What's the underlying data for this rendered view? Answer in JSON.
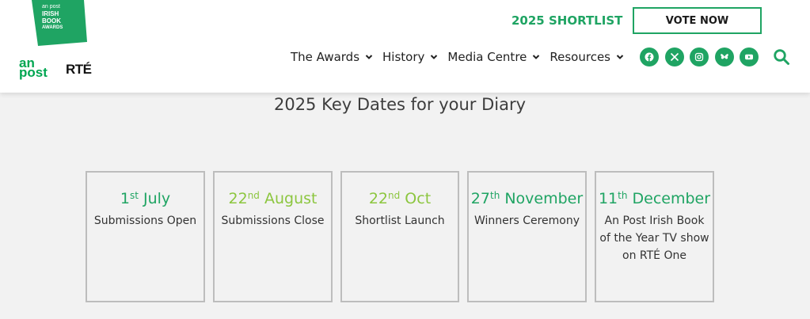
{
  "branding": {
    "badge_small": "an post",
    "badge_line1": "IRISH",
    "badge_line2": "BOOK",
    "badge_line3": "AWARDS",
    "anpost_line1": "an",
    "anpost_line2": "post",
    "rte": "RTÉ"
  },
  "header": {
    "shortlist_label": "2025 SHORTLIST",
    "vote_label": "VOTE NOW"
  },
  "nav": [
    {
      "label": "The Awards"
    },
    {
      "label": "History"
    },
    {
      "label": "Media Centre"
    },
    {
      "label": "Resources"
    }
  ],
  "socials": [
    "facebook-icon",
    "x-icon",
    "instagram-icon",
    "bluesky-icon",
    "youtube-icon"
  ],
  "colors": {
    "brand_green": "#1fa463",
    "lime_green": "#8cc63f",
    "border_gray": "#bdbdbd"
  },
  "main": {
    "title": "2025 Key Dates for your Diary",
    "cards": [
      {
        "day": "1",
        "suffix": "st",
        "month": "July",
        "desc": "Submissions Open",
        "color": "#1fa463"
      },
      {
        "day": "22",
        "suffix": "nd",
        "month": "August",
        "desc": "Submissions Close",
        "color": "#8cc63f"
      },
      {
        "day": "22",
        "suffix": "nd",
        "month": "Oct",
        "desc": "Shortlist Launch",
        "color": "#8cc63f"
      },
      {
        "day": "27",
        "suffix": "th",
        "month": "November",
        "desc": "Winners Ceremony",
        "color": "#1fa463"
      },
      {
        "day": "11",
        "suffix": "th",
        "month": "December",
        "desc": "An Post Irish Book of the Year TV show on RTÉ One",
        "color": "#1fa463"
      }
    ]
  }
}
